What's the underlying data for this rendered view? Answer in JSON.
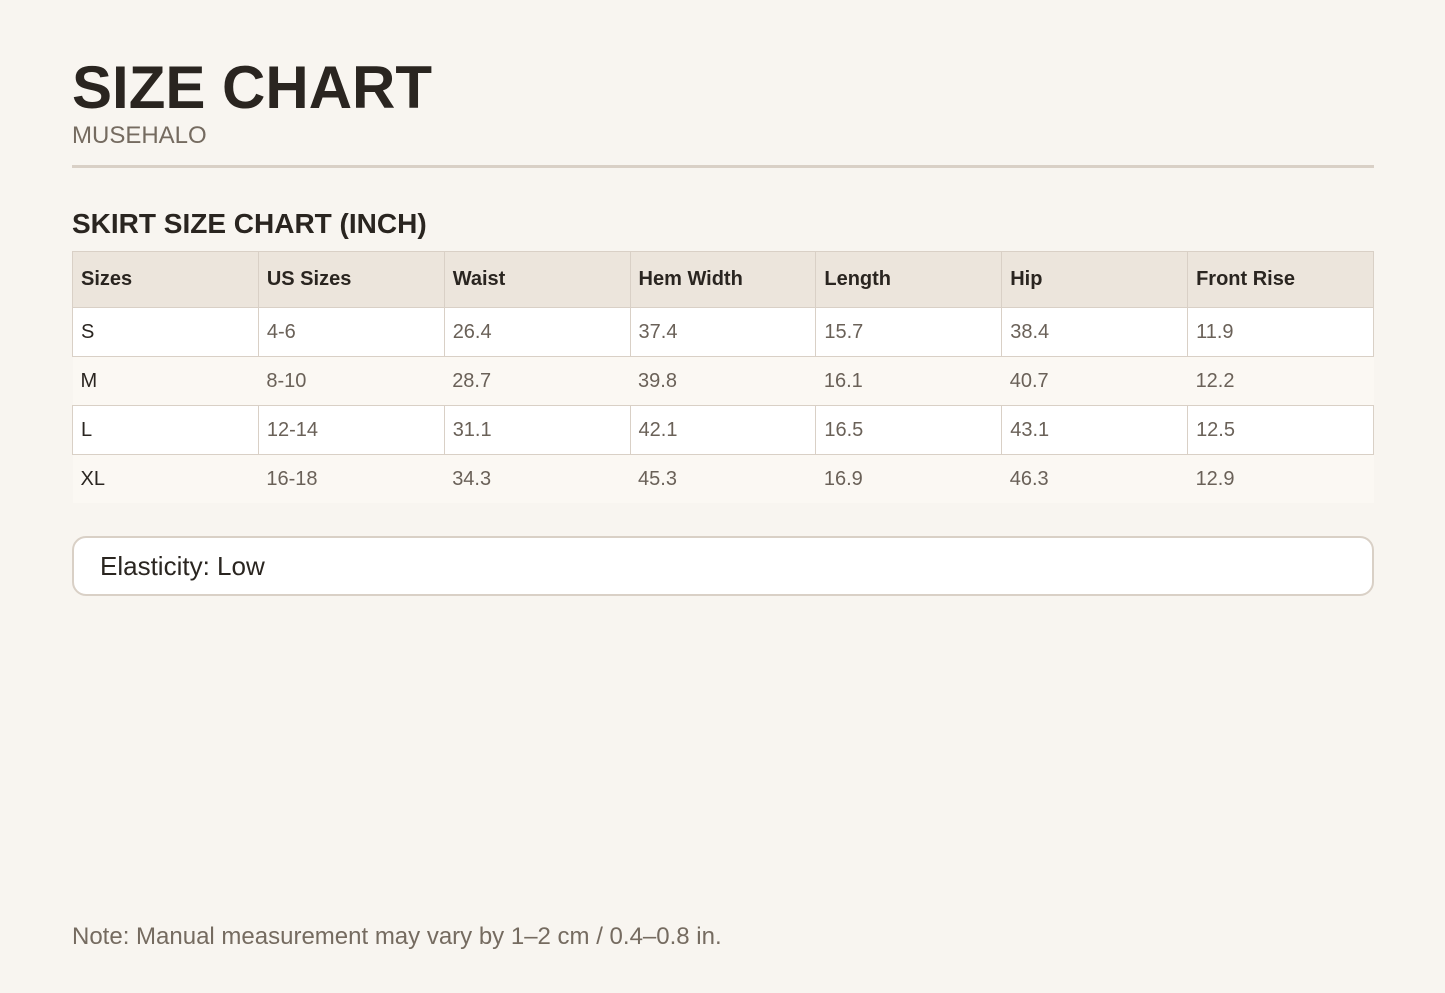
{
  "header": {
    "title": "SIZE CHART",
    "brand": "MUSEHALO"
  },
  "section": {
    "title": "SKIRT SIZE CHART (INCH)"
  },
  "table": {
    "columns": [
      "Sizes",
      "US Sizes",
      "Waist",
      "Hem Width",
      "Length",
      "Hip",
      "Front Rise"
    ],
    "rows": [
      [
        "S",
        "4-6",
        "26.4",
        "37.4",
        "15.7",
        "38.4",
        "11.9"
      ],
      [
        "M",
        "8-10",
        "28.7",
        "39.8",
        "16.1",
        "40.7",
        "12.2"
      ],
      [
        "L",
        "12-14",
        "31.1",
        "42.1",
        "16.5",
        "43.1",
        "12.5"
      ],
      [
        "XL",
        "16-18",
        "34.3",
        "45.3",
        "16.9",
        "46.3",
        "12.9"
      ]
    ]
  },
  "elasticity": {
    "text": "Elasticity: Low"
  },
  "footer": {
    "note": "Note: Manual measurement may vary by 1–2 cm / 0.4–0.8 in."
  },
  "colors": {
    "background": "#f8f5f0",
    "header_row": "#ece5dc",
    "border": "#d9d0c6",
    "text_dark": "#2a2520",
    "text_muted": "#756b60"
  }
}
